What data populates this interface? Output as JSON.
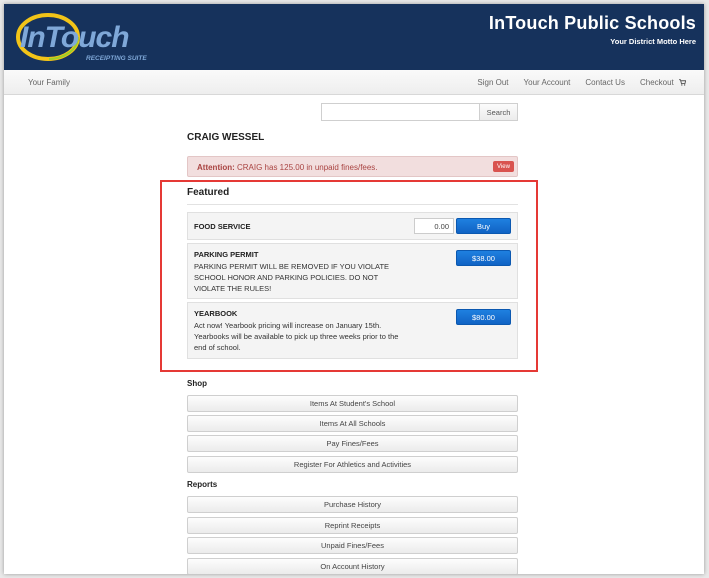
{
  "header": {
    "logo_text": "InTouch",
    "logo_subtext": "RECEIPTING SUITE",
    "title": "InTouch Public Schools",
    "motto": "Your District Motto Here"
  },
  "nav": {
    "left": "Your Family",
    "sign_out": "Sign Out",
    "account": "Your Account",
    "contact": "Contact Us",
    "checkout": "Checkout"
  },
  "search": {
    "value": "",
    "placeholder": "",
    "button_label": "Search"
  },
  "student_name": "CRAIG WESSEL",
  "alert": {
    "prefix": "Attention:",
    "message": "CRAIG has 125.00 in unpaid fines/fees.",
    "button_label": "View"
  },
  "featured": {
    "title": "Featured",
    "items": [
      {
        "title": "FOOD SERVICE",
        "amount": "0.00",
        "button": "Buy"
      },
      {
        "title": "PARKING PERMIT",
        "desc": "PARKING PERMIT WILL BE REMOVED IF YOU VIOLATE SCHOOL HONOR AND PARKING POLICIES. DO NOT VIOLATE THE RULES!",
        "button": "$38.00"
      },
      {
        "title": "YEARBOOK",
        "desc": "Act now! Yearbook pricing will increase on January 15th. Yearbooks will be available to pick up three weeks prior to the end of school.",
        "button": "$80.00"
      }
    ]
  },
  "shop": {
    "title": "Shop",
    "items": [
      "Items At Student's School",
      "Items At All Schools",
      "Pay Fines/Fees",
      "Register For Athletics and Activities"
    ]
  },
  "reports": {
    "title": "Reports",
    "items": [
      "Purchase History",
      "Reprint Receipts",
      "Unpaid Fines/Fees",
      "On Account History"
    ]
  },
  "colors": {
    "header_bg": "#16325c",
    "primary_button": "#1063c4",
    "alert_bg": "#f2dede",
    "highlight_border": "#e53935"
  }
}
